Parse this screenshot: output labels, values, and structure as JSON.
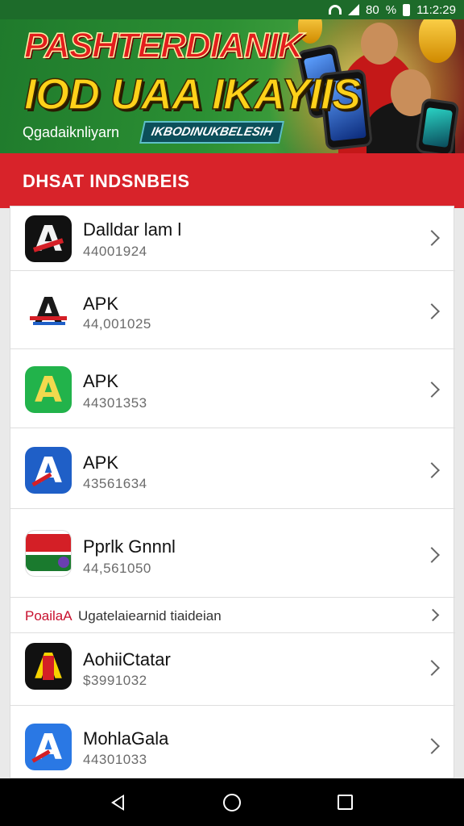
{
  "status_bar": {
    "left_text": "80",
    "percent": "%",
    "time": "11:2:29"
  },
  "banner": {
    "headline_line1": "PASHTERDIANIK",
    "headline_line2": "IOD UAA IKAYIIS",
    "tagline": "Qgadaiknliyarn",
    "pill_text": "IKBODINUKBELESIH"
  },
  "section": {
    "title": "DHSAT INDSNBEIS"
  },
  "list": {
    "items": [
      {
        "name": "Dalldar lam l",
        "code": "44001924",
        "icon": "a-logo-black-red-icon",
        "bg": "#111111",
        "fg": "#e8e8e8",
        "accent": "#d41f26"
      },
      {
        "name": "APK",
        "code": "44,001025",
        "icon": "a-logo-tricolor-icon",
        "bg": "#ffffff",
        "fg": "#1a1a1a",
        "accent": "#d41f26"
      },
      {
        "name": "APK",
        "code": "44301353",
        "icon": "a-logo-green-icon",
        "bg": "#22b34b",
        "fg": "#f2d94e",
        "accent": "#ffffff"
      },
      {
        "name": "APK",
        "code": "43561634",
        "icon": "a-logo-blue-icon",
        "bg": "#1f5fc7",
        "fg": "#ffffff",
        "accent": "#d41f26"
      },
      {
        "name": "Pprlk Gnnnl",
        "code": "44,561050",
        "icon": "store-badge-icon",
        "bg": "#ffffff",
        "fg": "#d41f26",
        "accent": "#1a7a2e"
      }
    ],
    "subheader": {
      "red_text": "PoailaA",
      "text": "Ugatelaiearnid tiaideian"
    },
    "items_after": [
      {
        "name": "AohiiCtatar",
        "code": "$3991032",
        "icon": "a-logo-yellow-icon",
        "bg": "#111111",
        "fg": "#f6d200",
        "accent": "#d41f26"
      },
      {
        "name": "MohlaGala",
        "code": "44301033",
        "icon": "a-logo-blue-light-icon",
        "bg": "#2a78e4",
        "fg": "#ffffff",
        "accent": "#d41f26"
      }
    ]
  },
  "nav": {
    "back": "back-icon",
    "home": "home-icon",
    "recent": "recent-apps-icon"
  }
}
